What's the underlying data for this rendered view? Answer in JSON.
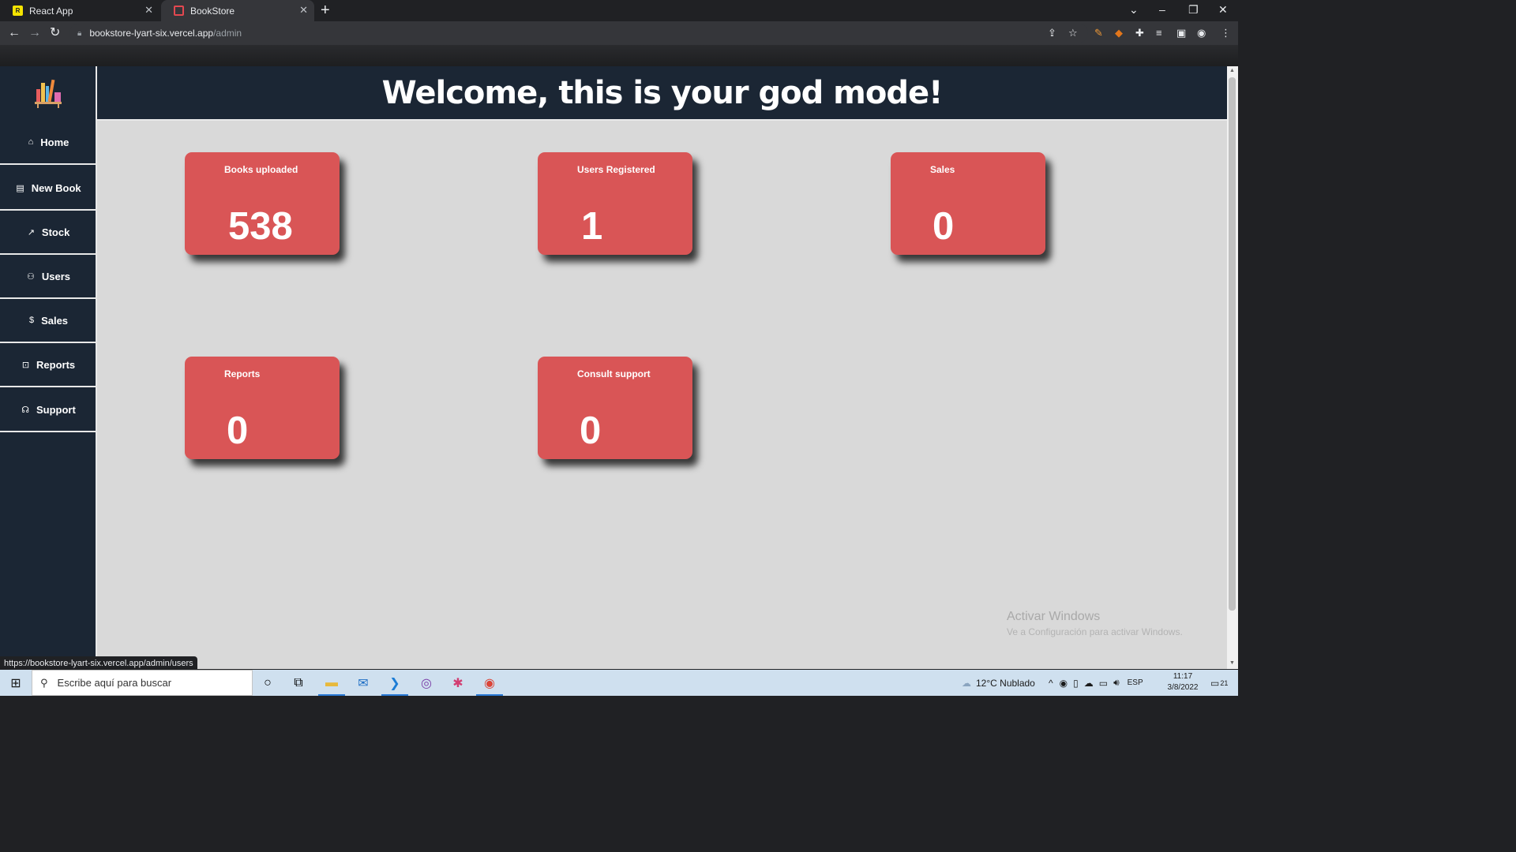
{
  "browser": {
    "tabs": [
      {
        "title": "React App",
        "favicon": "react-app-icon"
      },
      {
        "title": "BookStore",
        "favicon": "bookstore-icon"
      }
    ],
    "url_host": "bookstore-lyart-six.vercel.app",
    "url_path": "/admin",
    "status_url": "https://bookstore-lyart-six.vercel.app/admin/users"
  },
  "header": {
    "title": "Welcome, this is your god mode!"
  },
  "sidebar": {
    "items": [
      {
        "label": "Home",
        "icon": "home-icon"
      },
      {
        "label": "New Book",
        "icon": "book-add-icon"
      },
      {
        "label": "Stock",
        "icon": "trend-icon"
      },
      {
        "label": "Users",
        "icon": "user-icon"
      },
      {
        "label": "Sales",
        "icon": "dollar-icon"
      },
      {
        "label": "Reports",
        "icon": "report-icon"
      },
      {
        "label": "Support",
        "icon": "headset-icon"
      }
    ]
  },
  "cards": [
    {
      "title": "Books uploaded",
      "value": "538"
    },
    {
      "title": "Users Registered",
      "value": "1"
    },
    {
      "title": "Sales",
      "value": "0"
    },
    {
      "title": "Reports",
      "value": "0"
    },
    {
      "title": "Consult support",
      "value": "0"
    }
  ],
  "watermark": {
    "line1": "Activar Windows",
    "line2": "Ve a Configuración para activar Windows."
  },
  "taskbar": {
    "search_placeholder": "Escribe aquí para buscar",
    "weather": "12°C  Nublado",
    "language": "ESP",
    "time": "11:17",
    "date": "3/8/2022",
    "notifications": "21"
  },
  "colors": {
    "card": "#d95556",
    "sidebar": "#1b2634",
    "content_bg": "#d9d9d9"
  }
}
